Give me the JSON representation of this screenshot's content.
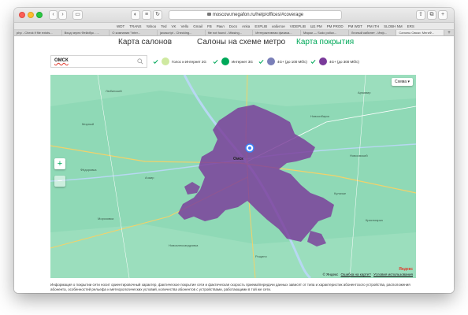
{
  "browser": {
    "address": "moscow.megafon.ru/help/offices/#coverage",
    "bookmarks": [
      "WDT",
      "TRANS",
      "Yahoo",
      "Ted",
      "VK",
      "Vello",
      "Gmail",
      "FB",
      "Ракл",
      "Docs",
      "Anka",
      "EXPLIB",
      "избитое",
      "VIDEPLIB",
      "Ш1 PM",
      "PM PROD",
      "PM WDT",
      "PM ITH",
      "SLOBH NM",
      "ERS"
    ],
    "tabs": [
      "php - Check if file exists...",
      "Вход через Фейсбук - ...",
      "О компании \"Inter...",
      "javascript - Checking...",
      "file not found - Missing...",
      "Интерактивная физика...",
      "Марки — Sudo pollux...",
      "Личный кабинет - Инф...",
      "Салоны Связи: МегаФ..."
    ]
  },
  "nav": {
    "salons": "Карта салонов",
    "metro": "Салоны на схеме метро",
    "coverage": "Карта покрытия"
  },
  "search": {
    "value": "ОМСК"
  },
  "legend": [
    {
      "label": "Голос и Интернет 2G",
      "color": "#cfe9a0"
    },
    {
      "label": "Интернет 3G",
      "color": "#00a859"
    },
    {
      "label": "4G+ (до 100 Мб/с)",
      "color": "#7a7fb8"
    },
    {
      "label": "4G+ (до 300 Мб/с)",
      "color": "#7a3a9a"
    }
  ],
  "map": {
    "scheme_button": "Схема",
    "zoom_in": "+",
    "zoom_out": "−",
    "copyright": "© Яндекс",
    "error_link": "Ошибка на карте?",
    "terms_link": "Условия использования",
    "logo": "Яндекс",
    "places": [
      "Любинский",
      "Мирный",
      "Фёдоровка",
      "Морозовка",
      "Новосибирск",
      "Армавир",
      "Омск",
      "Новоомский",
      "Ачаир",
      "Кулачье",
      "Рощино",
      "Новоалександровка",
      "Красноярка"
    ]
  },
  "info_text": "Информация о покрытии сети носит ориентировочный характер, фактическое покрытие сети и фактическая скорость приема/передачи данных зависят от типа и характеристик абонентского устройства, расположения абонента, особенностей рельефа и метеорологических условий, количества абонентов с устройствами, работающими в той же сети.",
  "colors": {
    "accent": "#00a859",
    "coverage_4g": "#7a3a9a",
    "map_base": "#8fd9b6"
  }
}
